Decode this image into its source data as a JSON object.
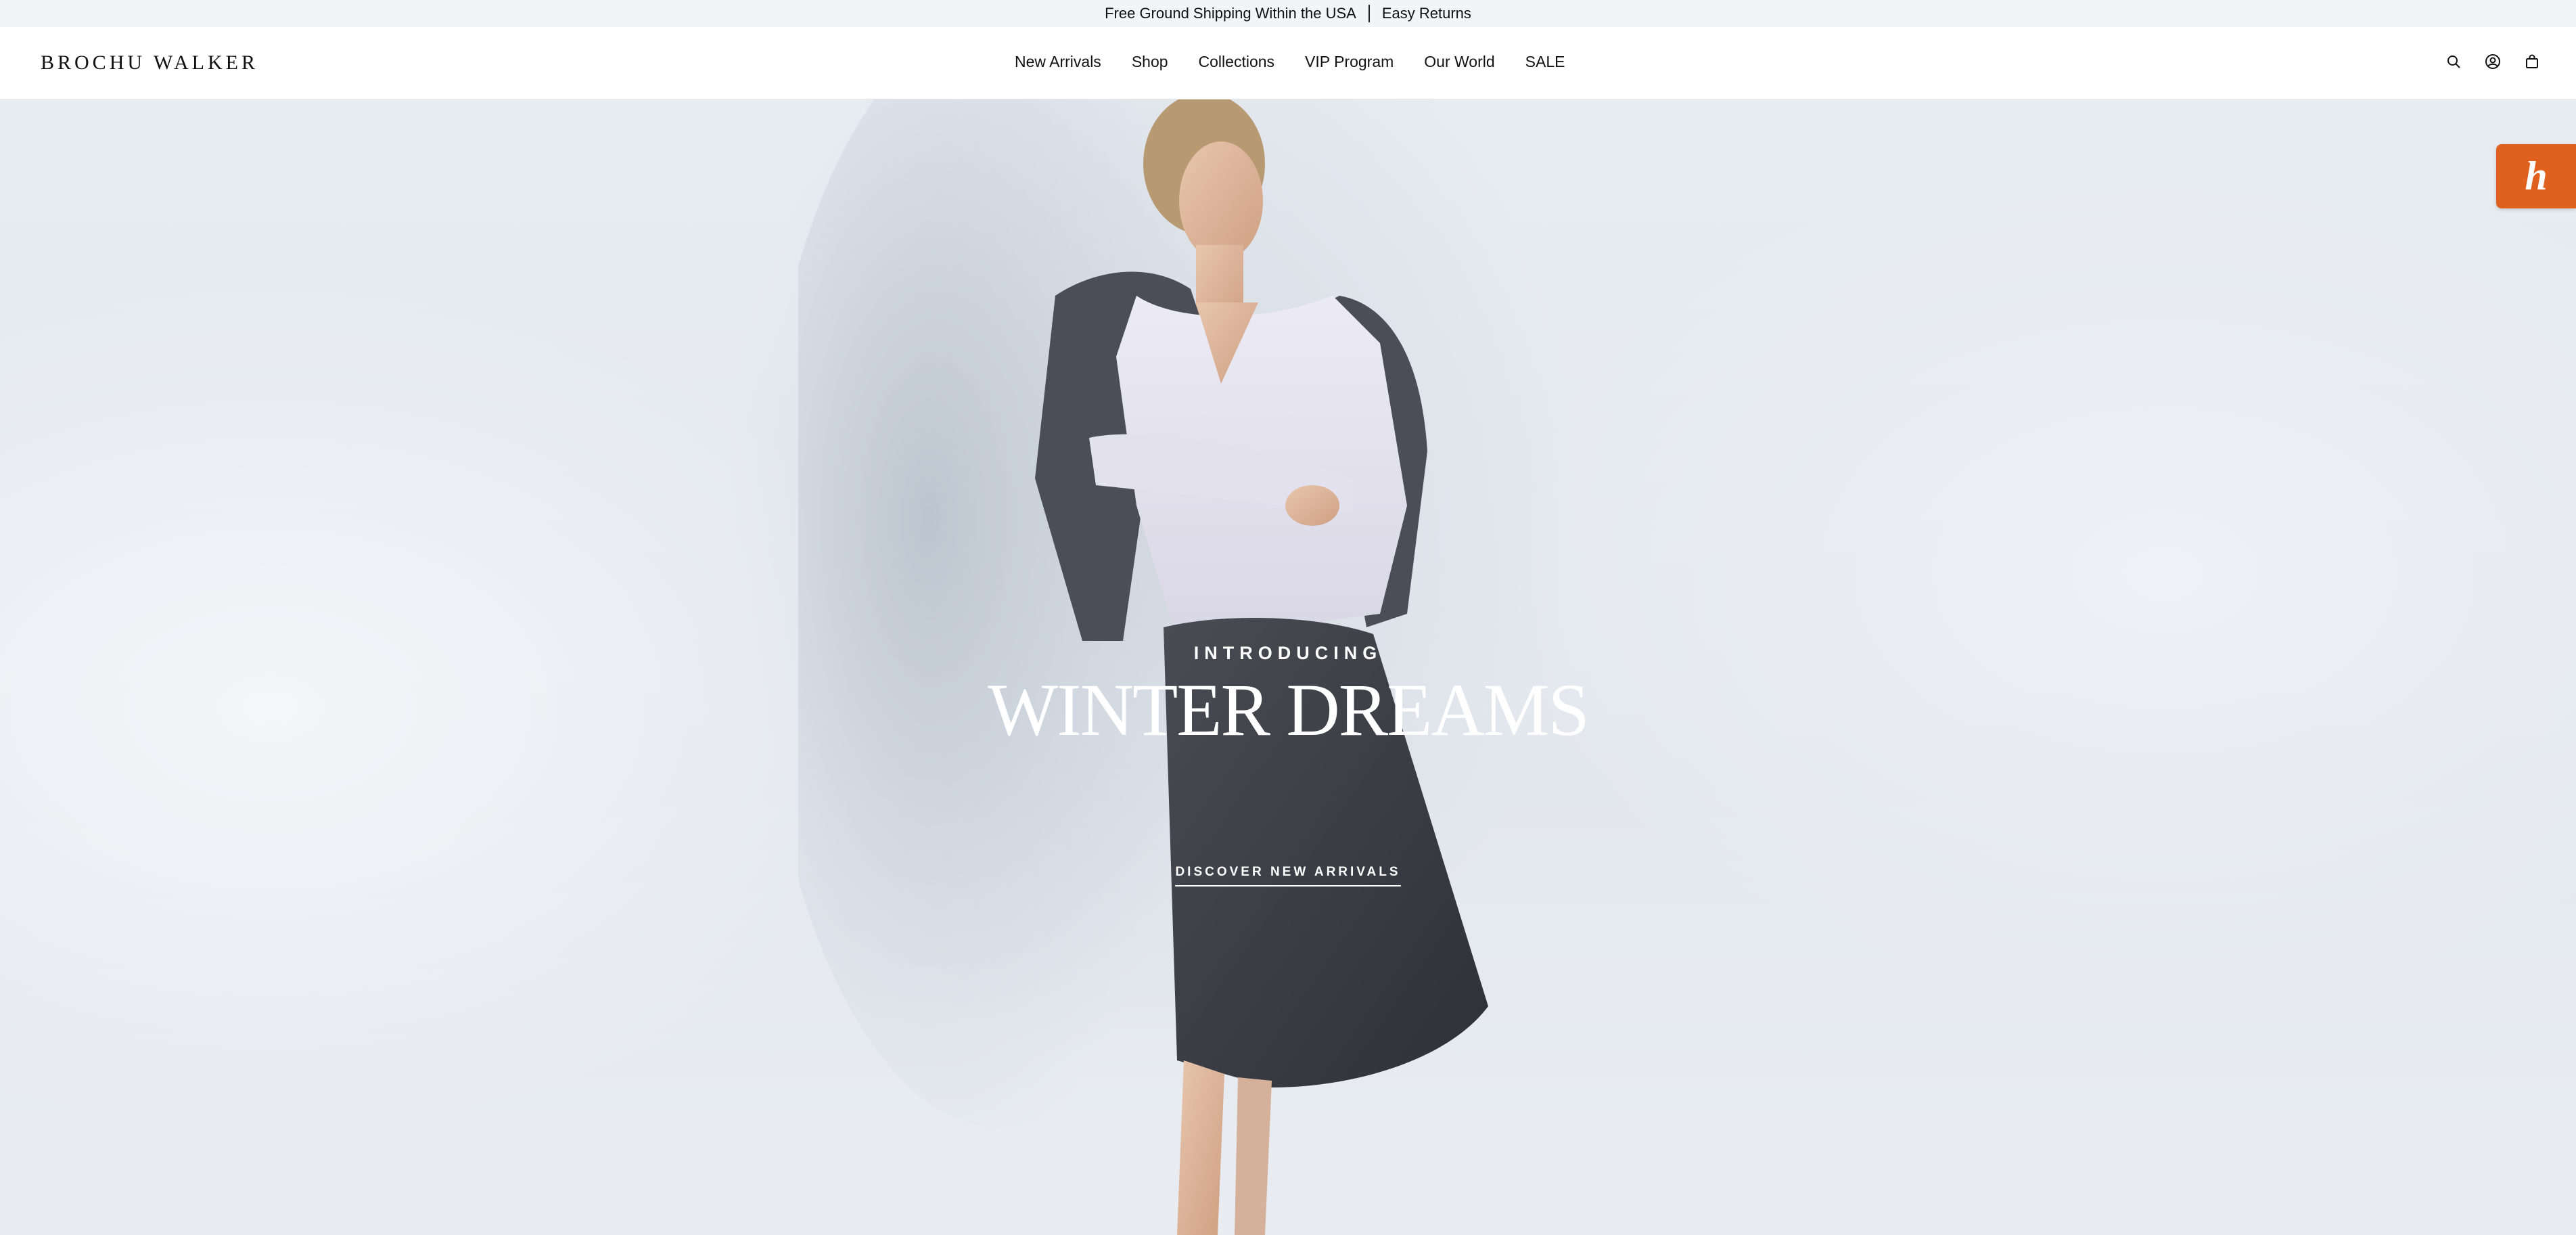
{
  "announcement": {
    "left": "Free Ground Shipping Within the USA",
    "right": "Easy Returns"
  },
  "header": {
    "logo": "BROCHU WALKER",
    "nav": [
      "New Arrivals",
      "Shop",
      "Collections",
      "VIP Program",
      "Our World",
      "SALE"
    ],
    "icons": [
      "search-icon",
      "account-icon",
      "cart-icon"
    ]
  },
  "hero": {
    "eyebrow": "INTRODUCING",
    "headline": "WINTER DREAMS",
    "cta": "DISCOVER NEW ARRIVALS"
  },
  "badge": {
    "letter": "h",
    "color": "#e0601e"
  }
}
